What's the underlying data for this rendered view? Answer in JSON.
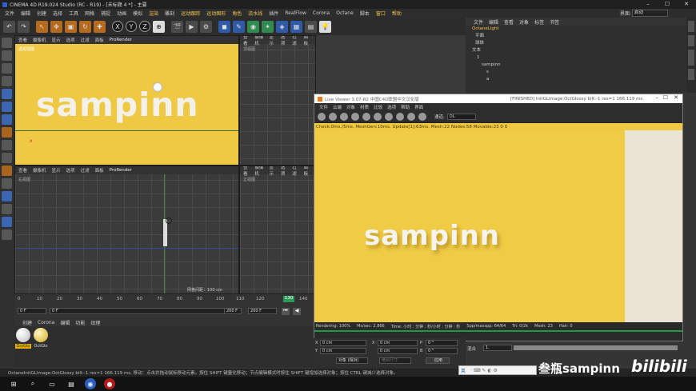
{
  "window": {
    "title": "CINEMA 4D R19.024 Studio (RC - R19) - [未标题 4 *] - 主要"
  },
  "menu": [
    "文件",
    "编辑",
    "创建",
    "选择",
    "工具",
    "网格",
    "捕捉",
    "动画",
    "模拟",
    "渲染",
    "雕刻",
    "运动跟踪",
    "运动图形",
    "角色",
    "流水线",
    "插件",
    "RealFlow",
    "Corona",
    "Octane",
    "脚本",
    "窗口",
    "帮助"
  ],
  "layout": {
    "label": "界面:",
    "value": "启动"
  },
  "object_manager": {
    "menu": [
      "文件",
      "编辑",
      "查看",
      "对象",
      "标签",
      "书签"
    ],
    "objects": [
      "OctaneLight",
      "平面",
      "球体",
      "文本",
      "1",
      "sampinn",
      "s",
      "a"
    ]
  },
  "viewport_menu": [
    "查看",
    "摄像机",
    "显示",
    "选项",
    "过滤",
    "面板",
    "ProRender"
  ],
  "viewports": {
    "perspective": {
      "label": "透视视图",
      "text": "sampinn"
    },
    "top": {
      "label": "顶视图"
    },
    "right": {
      "label": "右视图",
      "grid_info": "网格间距：100 cm"
    },
    "front": {
      "label": "正视图"
    }
  },
  "timeline": {
    "ticks": [
      "0",
      "10",
      "20",
      "30",
      "40",
      "50",
      "60",
      "70",
      "80",
      "90",
      "100",
      "110",
      "120",
      "130",
      "140"
    ],
    "current": "130",
    "start": "0 F",
    "end": "200 F",
    "end2": "200 F",
    "left_field": "0 F"
  },
  "materials": {
    "tabs": [
      "创建",
      "Corona",
      "编辑",
      "功能",
      "纹理"
    ],
    "items": [
      "OctGlo",
      "OctGlo"
    ]
  },
  "live_viewer": {
    "title": "Live Viewer 3.07-R2 中国C4D联盟中文汉化版",
    "status_right": "[FINISHED] InitGLImage:OctGlossy  bilt:-1 res=1  166.119 ms.",
    "menu": [
      "文件",
      "云端",
      "对象",
      "材质",
      "比较",
      "选项",
      "帮助",
      "界面"
    ],
    "channel_label": "通道:",
    "channel_value": "DL",
    "status": "Check:0ms./5ms. MeshGen:10ms. Update[1]:63ms. Mesh:22 Nodes:58 Movable:23  0 0",
    "render_text": "sampinn",
    "footer": [
      "Rendering: 100%",
      "Ms/sec: 2.866",
      "Time: 小时 : 分钟 : 秒/小时 : 分钟 : 秒",
      "Spp/maxspp: 64/64",
      "Tri: 0/2k",
      "Mesh: 23",
      "Hair: 0"
    ]
  },
  "coords": {
    "x": "0 cm",
    "y": "0 cm",
    "z": "0 cm",
    "x2": "0 cm",
    "y2": "0 cm",
    "z2": "0 cm",
    "h": "0 °",
    "p": "0 °",
    "b": "0 °",
    "mode1": "对象 (相对)",
    "mode2": "绝对尺寸",
    "apply": "应用"
  },
  "attributes": {
    "mix_label": "混合",
    "mix_value": "1."
  },
  "statusbar": "OctaneInitGLImage:OctGlossy  bilt:-1 res=1  166.119 ms.  移动：点击并拖动鼠标移动元素。按住 SHIFT 键量化移动；节点编辑模式时按住 SHIFT 键增加选择对象；按住 CTRL 键减少选择对象。",
  "watermark": "叁瓶sampinn",
  "bilibili": "bilibili",
  "ime": "英",
  "side_tabs": [
    "对象",
    "场次",
    "内容浏览器",
    "构造",
    "属性",
    "层"
  ]
}
